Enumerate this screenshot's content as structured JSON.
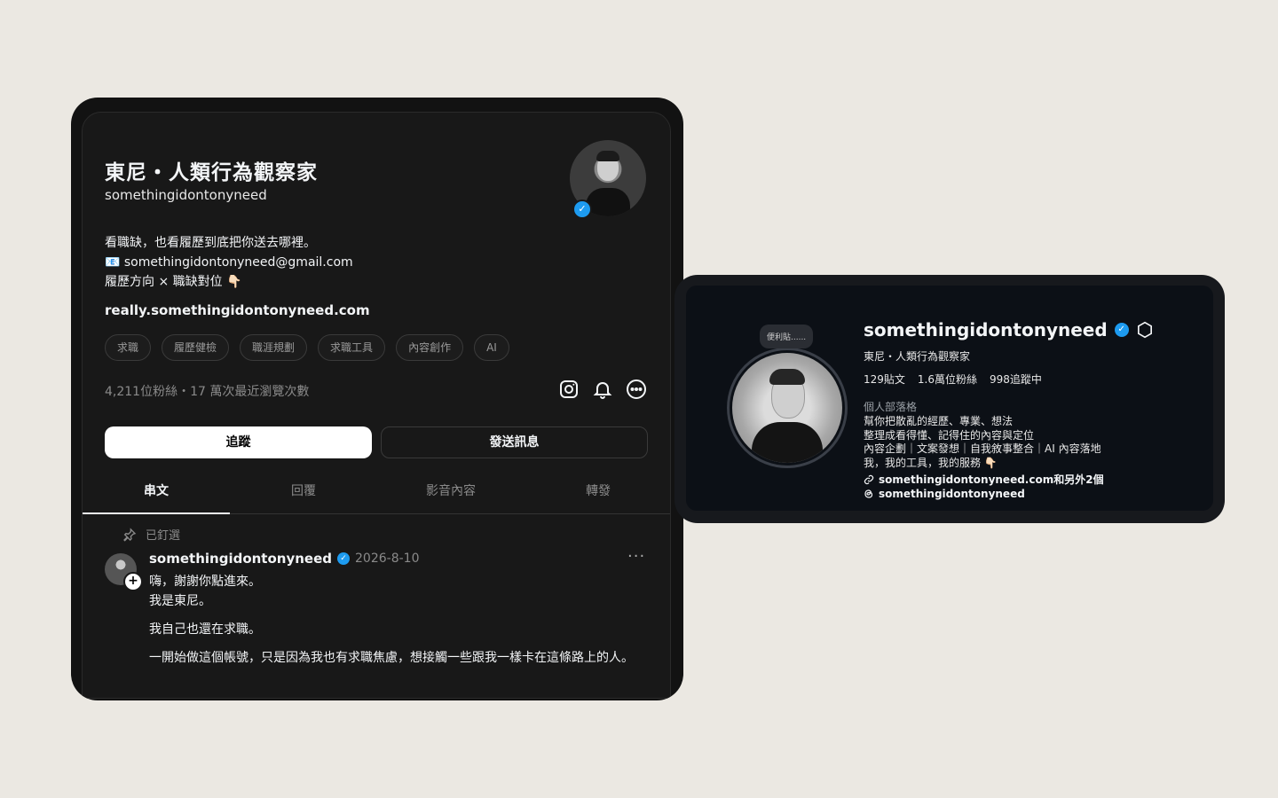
{
  "threads": {
    "display_name": "東尼・人類行為觀察家",
    "username": "somethingidontonyneed",
    "bio_lines": [
      "看職缺，也看履歷到底把你送去哪裡。",
      "📧 somethingidontonyneed@gmail.com",
      "履歷方向 × 職缺對位 👇🏻"
    ],
    "link": "really.somethingidontonyneed.com",
    "tags": [
      "求職",
      "履歷健檢",
      "職涯規劃",
      "求職工具",
      "內容創作",
      "AI"
    ],
    "stats": "4,211位粉絲・17 萬次最近瀏覽次數",
    "follow_label": "追蹤",
    "message_label": "發送訊息",
    "tabs": [
      "串文",
      "回覆",
      "影音內容",
      "轉發"
    ],
    "pinned_label": "已釘選",
    "post": {
      "username": "somethingidontonyneed",
      "date": "2026-8-10",
      "more": "···",
      "paragraphs": [
        "嗨，謝謝你點進來。\n我是東尼。",
        "我自己也還在求職。",
        "一開始做這個帳號，只是因為我也有求職焦慮，想接觸一些跟我一樣卡在這條路上的人。"
      ]
    }
  },
  "instagram": {
    "note": "便利貼......",
    "username": "somethingidontonyneed",
    "full_name": "東尼・人類行為觀察家",
    "stats": [
      "129貼文",
      "1.6萬位粉絲",
      "998追蹤中"
    ],
    "category": "個人部落格",
    "bio_lines": [
      "幫你把散亂的經歷、專業、想法",
      "整理成看得懂、記得住的內容與定位",
      "內容企劃｜文案發想｜自我敘事整合｜AI 內容落地",
      "我，我的工具，我的服務 👇🏻"
    ],
    "link": "somethingidontonyneed.com和另外2個",
    "threads_handle": "somethingidontonyneed"
  }
}
